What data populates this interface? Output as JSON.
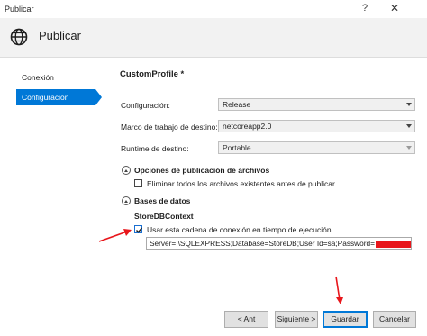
{
  "window": {
    "title": "Publicar",
    "help": "?",
    "close": "✕"
  },
  "header": {
    "title": "Publicar",
    "icon": "globe-icon"
  },
  "nav": [
    {
      "label": "Conexión",
      "active": false
    },
    {
      "label": "Configuración",
      "active": true
    }
  ],
  "profile": {
    "name": "CustomProfile *"
  },
  "settings": {
    "configuration": {
      "label": "Configuración:",
      "value": "Release"
    },
    "framework": {
      "label": "Marco de trabajo de destino:",
      "value": "netcoreapp2.0"
    },
    "runtime": {
      "label": "Runtime de destino:",
      "value": "Portable"
    }
  },
  "publish_options": {
    "title": "Opciones de publicación de archivos",
    "delete_existing": {
      "label": "Eliminar todos los archivos existentes antes de publicar",
      "checked": false
    }
  },
  "databases": {
    "title": "Bases de datos",
    "context": "StoreDBContext",
    "use_runtime_conn": {
      "label": "Usar esta cadena de conexión en tiempo de ejecución",
      "checked": true
    },
    "connection_string": "Server=.\\SQLEXPRESS;Database=StoreDB;User Id=sa;Password="
  },
  "buttons": {
    "back": "< Ant",
    "next": "Siguiente >",
    "save": "Guardar",
    "cancel": "Cancelar"
  },
  "colors": {
    "accent": "#0078d7",
    "annotation": "#e8161b"
  }
}
